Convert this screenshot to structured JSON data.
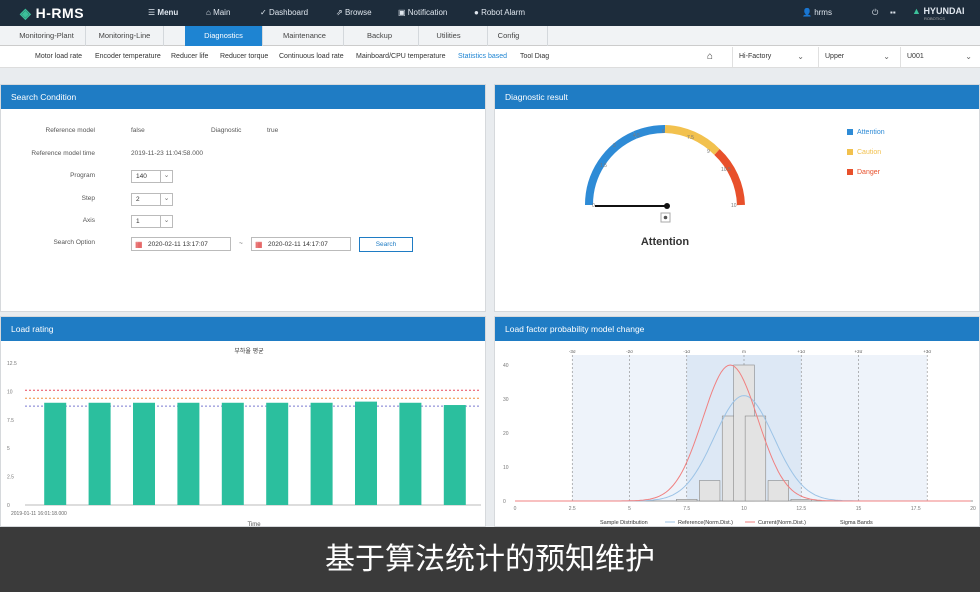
{
  "header": {
    "logo": "H-RMS",
    "menu": "Menu",
    "main": "Main",
    "dashboard": "Dashboard",
    "browse": "Browse",
    "notification": "Notification",
    "robot_alarm": "Robot Alarm",
    "user": "hrms",
    "brand": "HYUNDAI",
    "brand_sub": "ROBOTICS"
  },
  "tabs": [
    "Monitoring-Plant",
    "Monitoring-Line",
    "Diagnostics",
    "Maintenance",
    "Backup",
    "Utilities",
    "Config"
  ],
  "subtabs": [
    "Motor load rate",
    "Encoder temperature",
    "Reducer life",
    "Reducer torque",
    "Continuous load rate",
    "Mainboard/CPU temperature",
    "Statistics based",
    "Tool Diag"
  ],
  "selectors": [
    "Hi-Factory",
    "Upper",
    "U001"
  ],
  "search": {
    "title": "Search Condition",
    "reference_model_label": "Reference model",
    "reference_model_value": "false",
    "diagnostic_label": "Diagnostic",
    "diagnostic_value": "true",
    "ref_time_label": "Reference model time",
    "ref_time_value": "2019-11-23 11:04:58.000",
    "program_label": "Program",
    "program_value": "140",
    "step_label": "Step",
    "step_value": "2",
    "axis_label": "Axis",
    "axis_value": "1",
    "option_label": "Search Option",
    "start": "2020-02-11 13:17:07",
    "sep": "~",
    "end": "2020-02-11 14:17:07",
    "button": "Search"
  },
  "diag": {
    "title": "Diagnostic result",
    "status": "Attention",
    "legend": [
      "Attention",
      "Caution",
      "Danger"
    ],
    "colors": [
      "#2e8bd6",
      "#f2c14e",
      "#e8502b"
    ],
    "gauge_min": "0",
    "gauge_max": "10",
    "gauge_value": 0,
    "ticks": [
      "1.5",
      "3",
      "4.5",
      "6",
      "7.5",
      "9",
      "10.5"
    ]
  },
  "load": {
    "title": "Load rating",
    "chart_title": "부하율 평균",
    "timestamp": "2019-01-11 16:01:18.000",
    "xlabel": "Time"
  },
  "prob": {
    "title": "Load factor probability model change",
    "legend": [
      "Sample Distribution",
      "Reference(Norm.Dist.)",
      "Current(Norm.Dist.)",
      "Sigma Bands"
    ],
    "sigma": [
      "-3σ",
      "-2σ",
      "-1σ",
      "m",
      "+1σ",
      "+2σ",
      "+3σ"
    ]
  },
  "caption": "基于算法统计的预知维护",
  "chart_data": [
    {
      "type": "bar",
      "title": "부하율 평균",
      "xlabel": "Time",
      "ylabel": "",
      "ylim": [
        0,
        12.5
      ],
      "yticks": [
        "0",
        "2.5",
        "5",
        "7.5",
        "10",
        "12.5"
      ],
      "values": [
        9.0,
        9.0,
        9.0,
        9.0,
        9.0,
        9.0,
        9.0,
        9.1,
        9.0,
        8.8
      ],
      "reference_lines": [
        {
          "value": 10.1,
          "color": "#e9485c"
        },
        {
          "value": 9.4,
          "color": "#f08a3a"
        },
        {
          "value": 8.7,
          "color": "#7a7ad0"
        }
      ]
    },
    {
      "type": "bar",
      "title": "",
      "xlim": [
        0,
        20
      ],
      "ylim": [
        0,
        40
      ],
      "xticks": [
        "0",
        "2.5",
        "5",
        "7.5",
        "10",
        "12.5",
        "15",
        "17.5",
        "20"
      ],
      "yticks": [
        "0",
        "10",
        "20",
        "30",
        "40"
      ],
      "bins": [
        {
          "x": 7.5,
          "y": 0.5
        },
        {
          "x": 8.5,
          "y": 6
        },
        {
          "x": 9.5,
          "y": 25
        },
        {
          "x": 10,
          "y": 40
        },
        {
          "x": 10.5,
          "y": 25
        },
        {
          "x": 11.5,
          "y": 6
        },
        {
          "x": 12.5,
          "y": 0.5
        }
      ],
      "series": [
        {
          "name": "Reference(Norm.Dist.)",
          "mean": 10,
          "sd": 1.3,
          "peak": 31
        },
        {
          "name": "Current(Norm.Dist.)",
          "mean": 9.4,
          "sd": 1.2,
          "peak": 40
        }
      ],
      "sigma_x": [
        2.5,
        5,
        7.5,
        10,
        12.5,
        15,
        18
      ]
    }
  ]
}
